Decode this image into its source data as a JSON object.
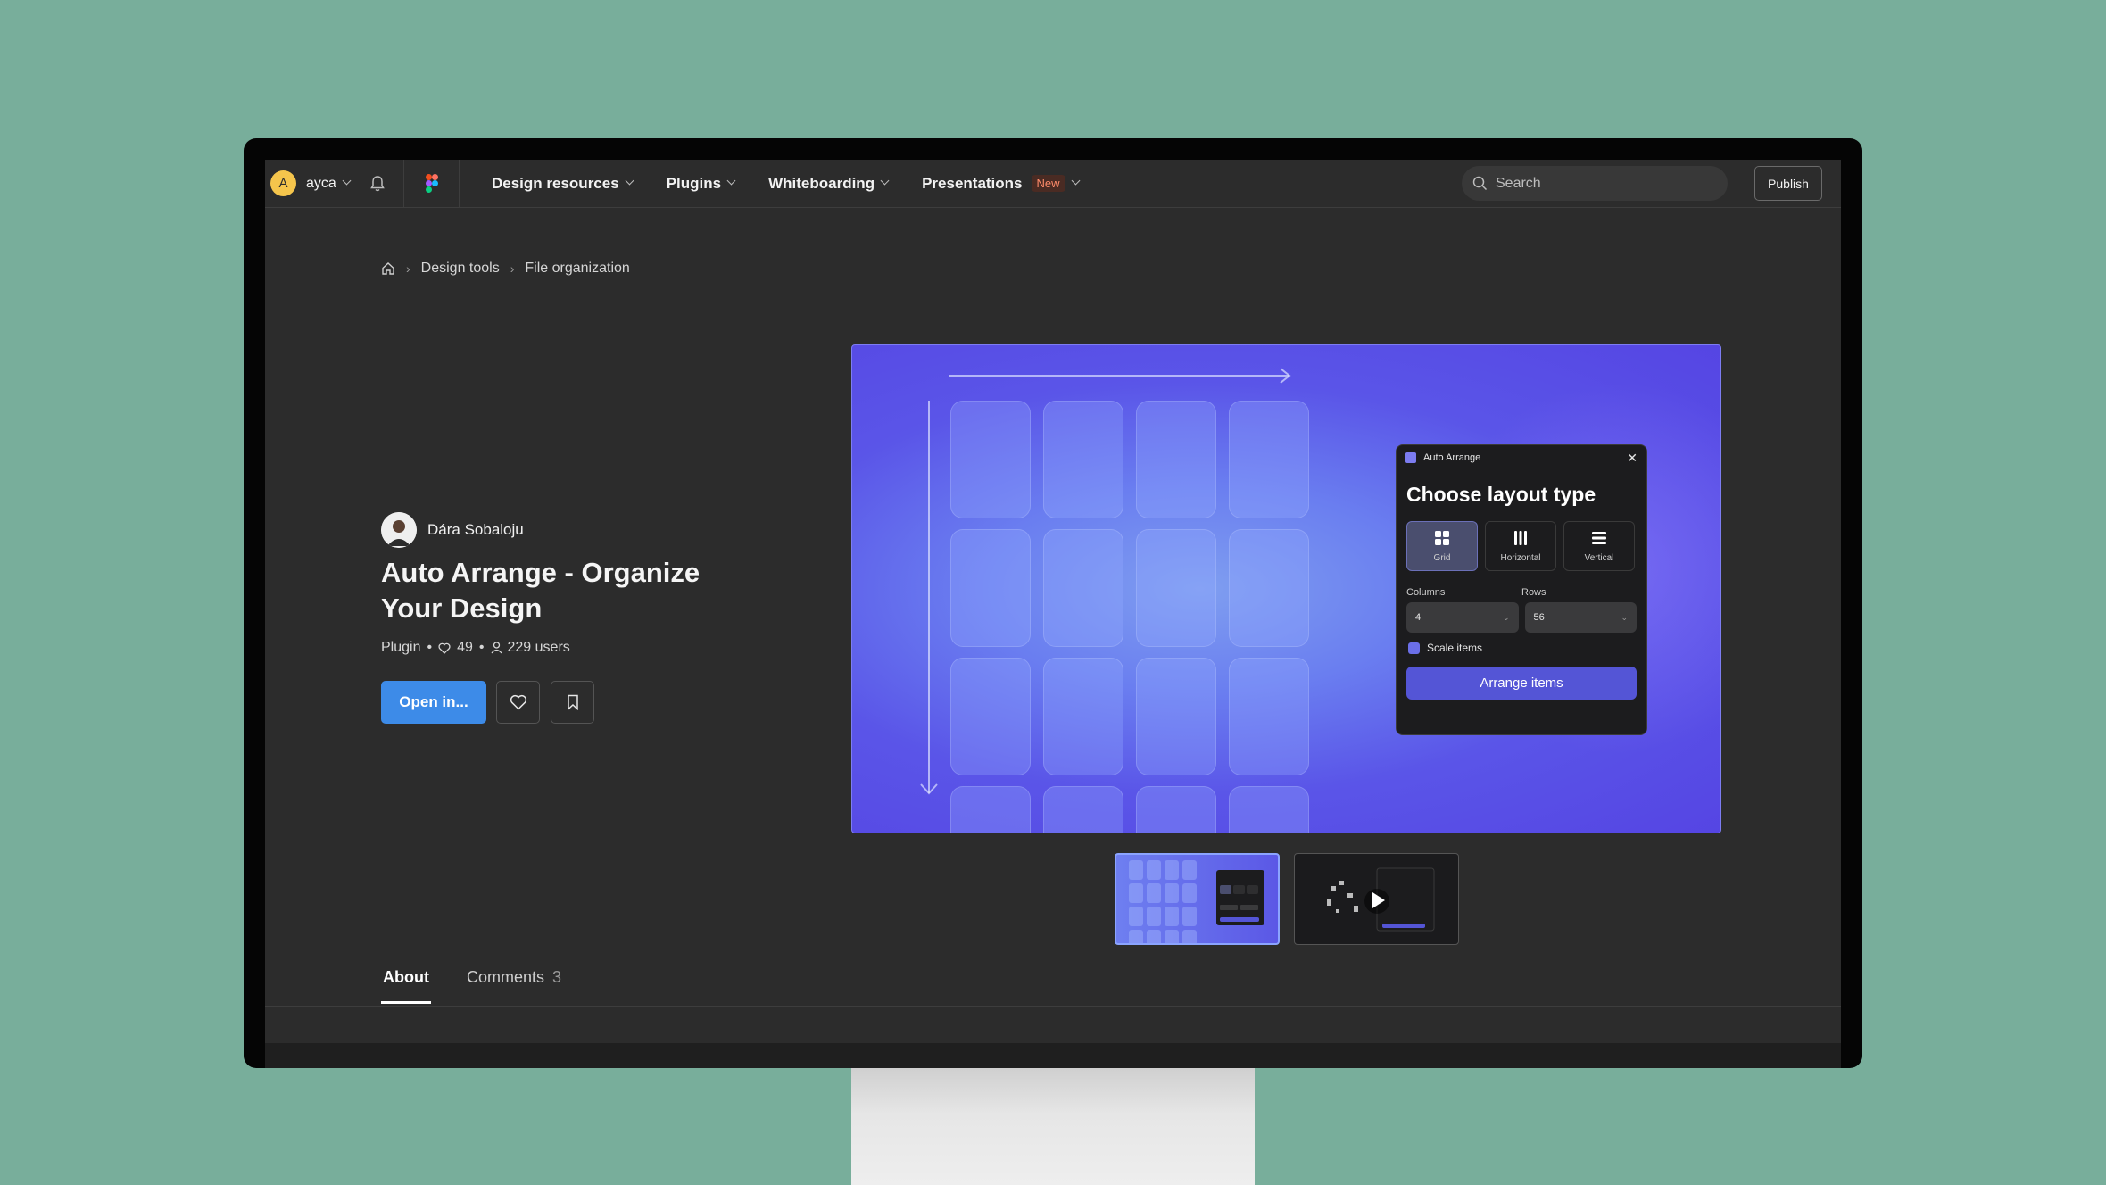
{
  "nav": {
    "user_initial": "A",
    "user_name": "ayca",
    "menu": [
      {
        "label": "Design resources"
      },
      {
        "label": "Plugins"
      },
      {
        "label": "Whiteboarding"
      },
      {
        "label": "Presentations",
        "badge": "New"
      }
    ],
    "search_placeholder": "Search",
    "publish_label": "Publish"
  },
  "breadcrumb": [
    "Design tools",
    "File organization"
  ],
  "plugin": {
    "author": "Dára Sobaloju",
    "title": "Auto Arrange - Organize Your Design",
    "type": "Plugin",
    "likes": "49",
    "users": "229 users",
    "open_label": "Open in..."
  },
  "preview_panel": {
    "title": "Auto Arrange",
    "heading": "Choose layout type",
    "options": [
      "Grid",
      "Horizontal",
      "Vertical"
    ],
    "selected_option": "Grid",
    "columns_label": "Columns",
    "rows_label": "Rows",
    "columns_value": "4",
    "rows_value": "56",
    "checkbox_label": "Scale items",
    "button_label": "Arrange items"
  },
  "tabs": {
    "about": "About",
    "comments": "Comments",
    "comments_count": "3"
  },
  "colors": {
    "accent": "#3d8be8",
    "background": "#78ae9b",
    "badge": "#ff8b6a"
  }
}
